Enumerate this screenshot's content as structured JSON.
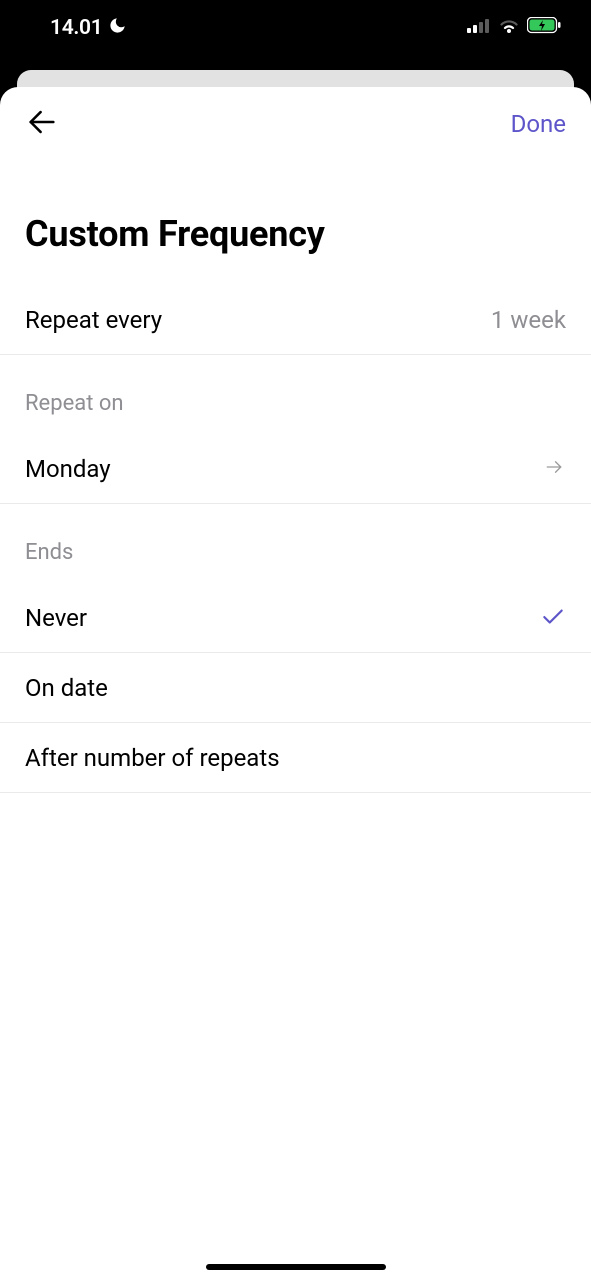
{
  "status": {
    "time": "14.01"
  },
  "nav": {
    "done": "Done"
  },
  "title": "Custom Frequency",
  "repeat_every": {
    "label": "Repeat every",
    "value": "1 week"
  },
  "repeat_on": {
    "header": "Repeat on",
    "value": "Monday"
  },
  "ends": {
    "header": "Ends",
    "options": [
      {
        "label": "Never",
        "selected": true
      },
      {
        "label": "On date",
        "selected": false
      },
      {
        "label": "After number of repeats",
        "selected": false
      }
    ]
  },
  "colors": {
    "accent": "#5d55c9"
  }
}
